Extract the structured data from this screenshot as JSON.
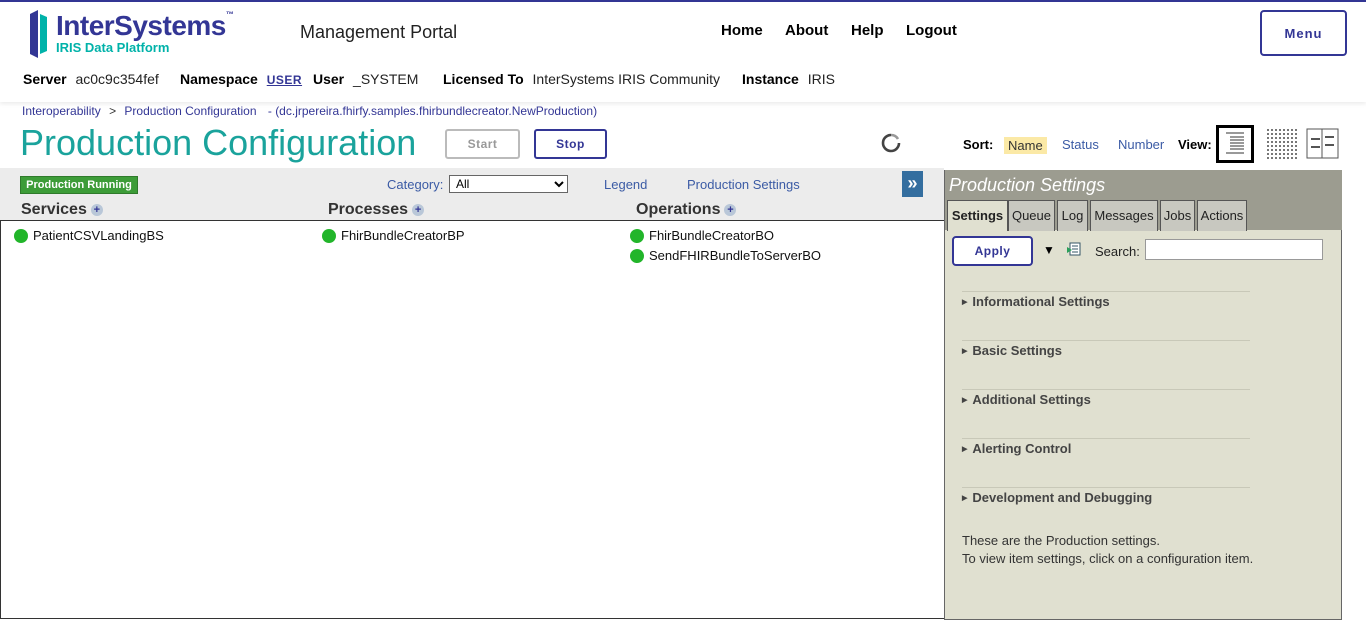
{
  "brand": {
    "name": "InterSystems",
    "tm": "™",
    "subtitle": "IRIS Data Platform",
    "primary_color": "#333695",
    "accent_color": "#00b2a9"
  },
  "header": {
    "portal_title": "Management Portal",
    "nav": [
      "Home",
      "About",
      "Help",
      "Logout"
    ],
    "menu_label": "Menu"
  },
  "info": {
    "server_label": "Server",
    "server_value": "ac0c9c354fef",
    "namespace_label": "Namespace",
    "namespace_value": "USER",
    "user_label": "User",
    "user_value": "_SYSTEM",
    "licensed_label": "Licensed To",
    "licensed_value": "InterSystems IRIS Community",
    "instance_label": "Instance",
    "instance_value": "IRIS"
  },
  "breadcrumb": {
    "root": "Interoperability",
    "separator": ">",
    "current": "Production Configuration",
    "production": "- (dc.jrpereira.fhirfy.samples.fhirbundlecreator.NewProduction)"
  },
  "page": {
    "title": "Production Configuration",
    "start_label": "Start",
    "stop_label": "Stop"
  },
  "sort": {
    "label": "Sort:",
    "options": [
      "Name",
      "Status",
      "Number"
    ],
    "active": "Name",
    "view_label": "View:"
  },
  "diagram": {
    "status_badge": "Production Running",
    "status_color": "#3d9c38",
    "category_label": "Category:",
    "category_value": "All",
    "legend_link": "Legend",
    "settings_link": "Production Settings",
    "expand_glyph": "»",
    "columns": {
      "services": {
        "label": "Services",
        "items": [
          "PatientCSVLandingBS"
        ]
      },
      "processes": {
        "label": "Processes",
        "items": [
          "FhirBundleCreatorBP"
        ]
      },
      "operations": {
        "label": "Operations",
        "items": [
          "FhirBundleCreatorBO",
          "SendFHIRBundleToServerBO"
        ]
      }
    },
    "running_color": "#22b52a"
  },
  "settings_panel": {
    "title": "Production Settings",
    "tabs": [
      "Settings",
      "Queue",
      "Log",
      "Messages",
      "Jobs",
      "Actions"
    ],
    "active_tab": "Settings",
    "apply_label": "Apply",
    "search_label": "Search:",
    "search_value": "",
    "sections": [
      "Informational Settings",
      "Basic Settings",
      "Additional Settings",
      "Alerting Control",
      "Development and Debugging"
    ],
    "note_line1": "These are the Production settings.",
    "note_line2": "To view item settings, click on a configuration item."
  }
}
